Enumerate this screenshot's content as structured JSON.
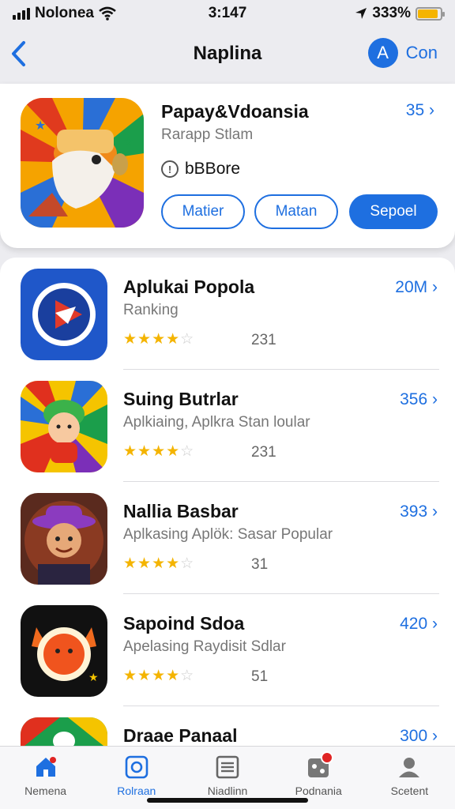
{
  "status_bar": {
    "carrier": "Nolonea",
    "time": "3:147",
    "battery": "333%",
    "battery_level": 0.9
  },
  "nav": {
    "back_icon": "chevron-left-icon",
    "title": "Naplina",
    "account_letter": "A",
    "account_label": "Con"
  },
  "featured": {
    "title": "Papay&Vdoansia",
    "subtitle": "Rarapp Stlam",
    "size": "35",
    "badge": "bBBore",
    "buttons": [
      {
        "label": "Matier",
        "style": "outline"
      },
      {
        "label": "Matan",
        "style": "outline"
      },
      {
        "label": "Sepoel",
        "style": "solid"
      }
    ]
  },
  "apps": [
    {
      "name": "Aplukai Popola",
      "subtitle": "Ranking",
      "size": "20M",
      "rating": 4,
      "count": "231",
      "icon": "play-icon"
    },
    {
      "name": "Suing Butrlar",
      "subtitle": "Aplkiaing, Aplkra Stan loular",
      "size": "356",
      "rating": 4,
      "count": "231",
      "icon": "character-icon"
    },
    {
      "name": "Nallia Basbar",
      "subtitle": "Aplkasing Aplök: Sasar Popular",
      "size": "393",
      "rating": 4,
      "count": "31",
      "icon": "hat-character-icon"
    },
    {
      "name": "Sapoind Sdoa",
      "subtitle": "Apelasing Raydisit Sdlar",
      "size": "420",
      "rating": 4,
      "count": "51",
      "icon": "fox-icon"
    },
    {
      "name": "Draae Panaal",
      "subtitle": "",
      "size": "300",
      "rating": 0,
      "count": "",
      "icon": "dog-icon"
    }
  ],
  "tabs": [
    {
      "label": "Nemena",
      "icon": "home-icon",
      "active": false
    },
    {
      "label": "Rolraan",
      "icon": "apps-icon",
      "active": true
    },
    {
      "label": "Niadlinn",
      "icon": "list-icon",
      "active": false
    },
    {
      "label": "Podnania",
      "icon": "games-icon",
      "active": false
    },
    {
      "label": "Scetent",
      "icon": "profile-icon",
      "active": false
    }
  ],
  "colors": {
    "accent": "#1e6fe0",
    "star": "#f4b400",
    "badge": "#e02424"
  }
}
